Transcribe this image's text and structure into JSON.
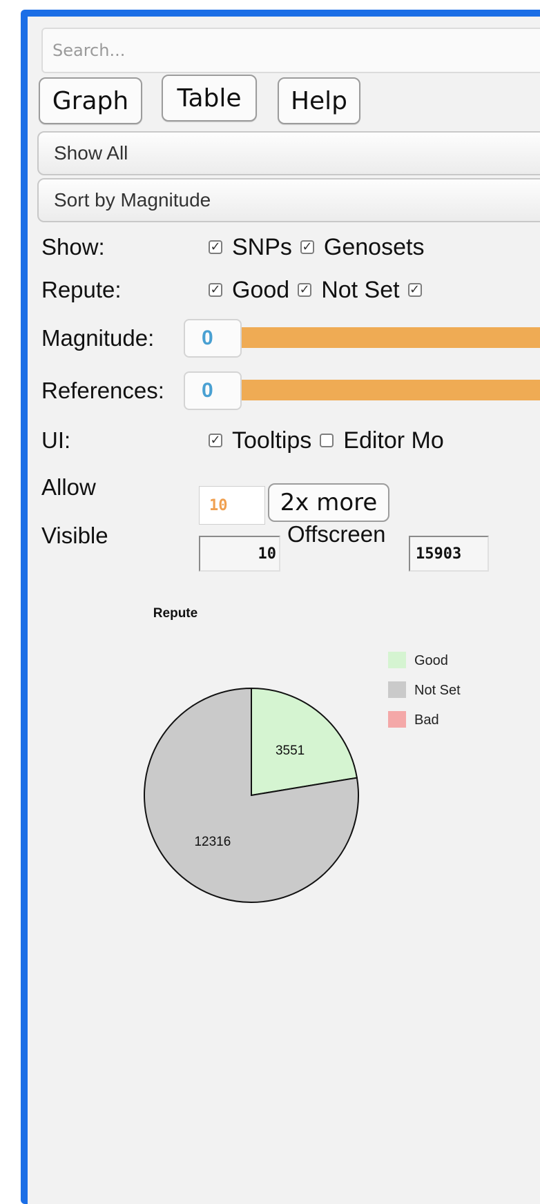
{
  "search": {
    "placeholder": "Search..."
  },
  "tabs": {
    "graph": "Graph",
    "table": "Table",
    "help": "Help"
  },
  "filters": {
    "show_mode": "Show All",
    "sort_mode": "Sort by Magnitude"
  },
  "options": {
    "show": {
      "label": "Show:",
      "items": [
        {
          "label": "SNPs",
          "checked": true
        },
        {
          "label": "Genosets",
          "checked": true
        }
      ]
    },
    "repute": {
      "label": "Repute:",
      "items": [
        {
          "label": "Good",
          "checked": true
        },
        {
          "label": "Not Set",
          "checked": true
        },
        {
          "label": "",
          "checked": true
        }
      ]
    },
    "magnitude": {
      "label": "Magnitude:",
      "value": "0"
    },
    "references": {
      "label": "References:",
      "value": "0"
    },
    "ui": {
      "label": "UI:",
      "items": [
        {
          "label": "Tooltips",
          "checked": true
        },
        {
          "label": "Editor Mo",
          "checked": false
        }
      ]
    },
    "allow": {
      "label": "Allow",
      "value": "10",
      "more_button": "2x more"
    },
    "visible": {
      "label": "Visible",
      "value": "10",
      "offscreen_label": "Offscreen",
      "offscreen_value": "15903"
    }
  },
  "colors": {
    "accent_frame": "#1b6ee6",
    "slider": "#efab54",
    "good": "#d5f4d1",
    "not_set": "#cacaca",
    "bad": "#f4a8a8"
  },
  "chart_data": {
    "type": "pie",
    "title": "Repute",
    "slices": [
      {
        "label": "Good",
        "value": 3551,
        "color": "#d5f4d1",
        "show_label": true
      },
      {
        "label": "Not Set",
        "value": 12316,
        "color": "#cacaca",
        "show_label": true
      },
      {
        "label": "Bad",
        "value": 0,
        "color": "#f4a8a8",
        "show_label": false
      }
    ],
    "legend": {
      "position": "right",
      "items": [
        "Good",
        "Not Set",
        "Bad"
      ]
    }
  }
}
